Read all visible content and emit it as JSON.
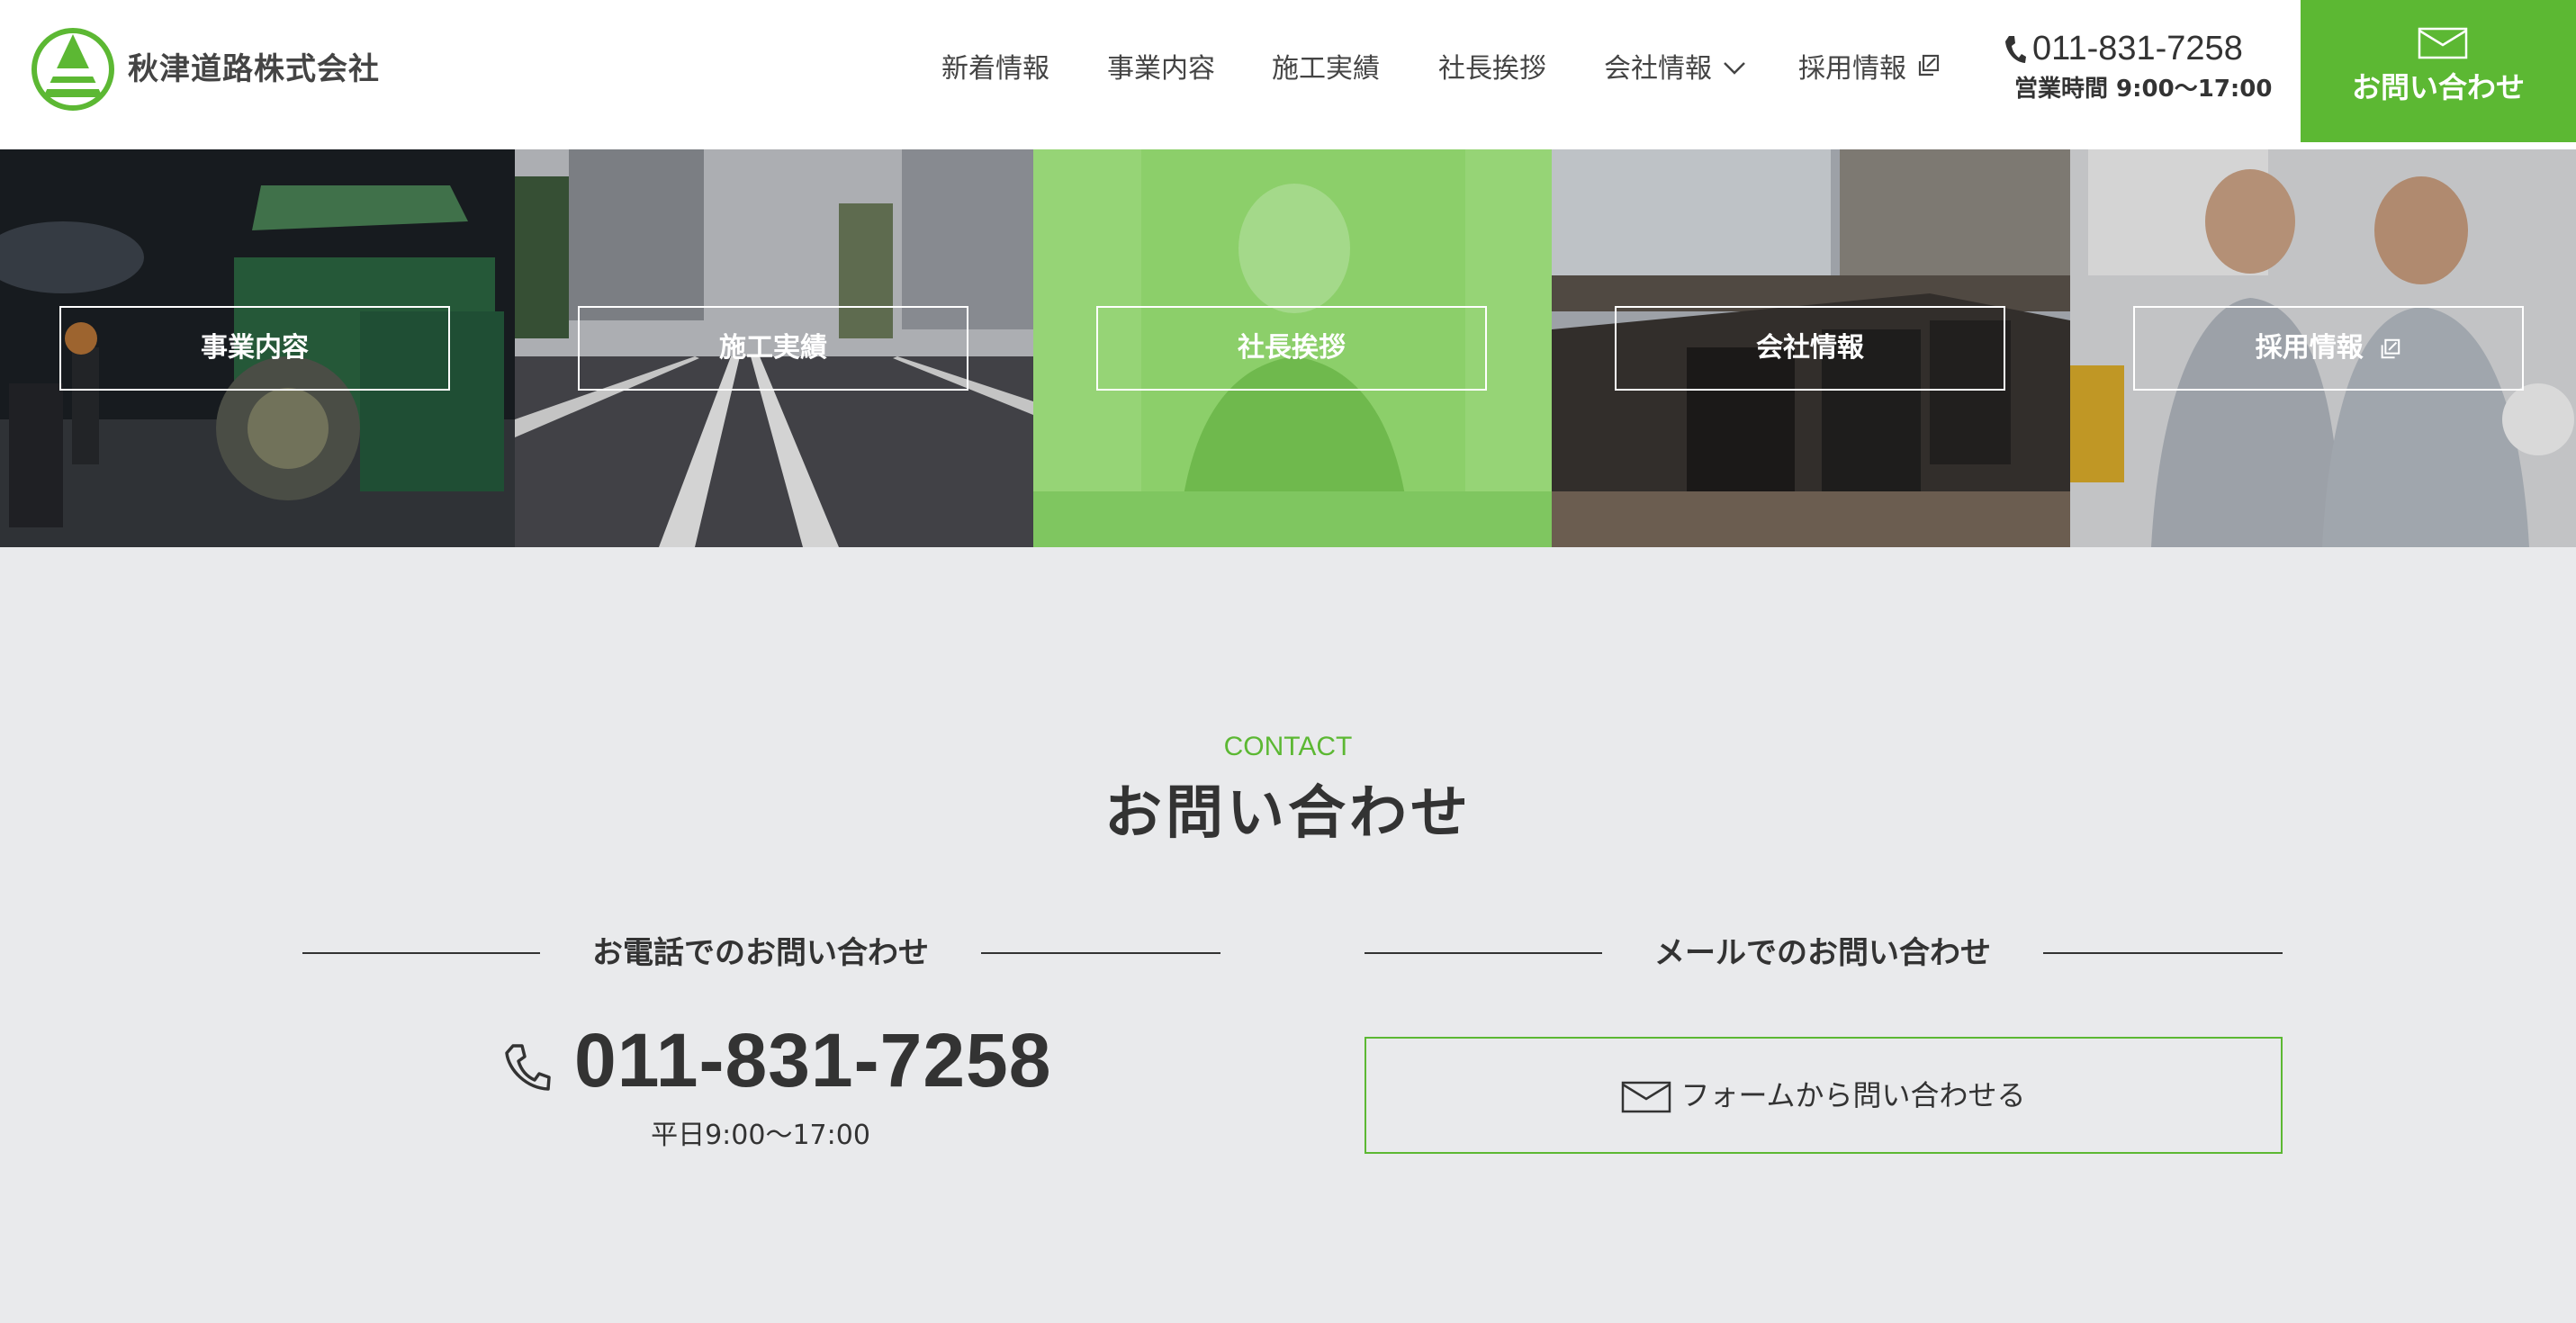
{
  "header": {
    "company_name": "秋津道路株式会社",
    "nav": [
      {
        "label": "新着情報"
      },
      {
        "label": "事業内容"
      },
      {
        "label": "施工実績"
      },
      {
        "label": "社長挨拶"
      },
      {
        "label": "会社情報"
      },
      {
        "label": "採用情報"
      }
    ],
    "phone": "011-831-7258",
    "hours": "営業時間 9:00〜17:00",
    "contact_button": "お問い合わせ"
  },
  "panels": [
    {
      "label": "事業内容"
    },
    {
      "label": "施工実績"
    },
    {
      "label": "社長挨拶"
    },
    {
      "label": "会社情報"
    },
    {
      "label": "採用情報"
    }
  ],
  "contact": {
    "eyebrow": "CONTACT",
    "title": "お問い合わせ",
    "phone_heading": "お電話でのお問い合わせ",
    "phone_number": "011-831-7258",
    "phone_hours": "平日9:00〜17:00",
    "mail_heading": "メールでのお問い合わせ",
    "form_button": "フォームから問い合わせる"
  },
  "colors": {
    "accent": "#5cb833",
    "background": "#e9eaec",
    "text": "#333333"
  },
  "icons": [
    "logo",
    "phone-icon",
    "mail-icon",
    "chevron-down-icon",
    "external-link-icon"
  ]
}
